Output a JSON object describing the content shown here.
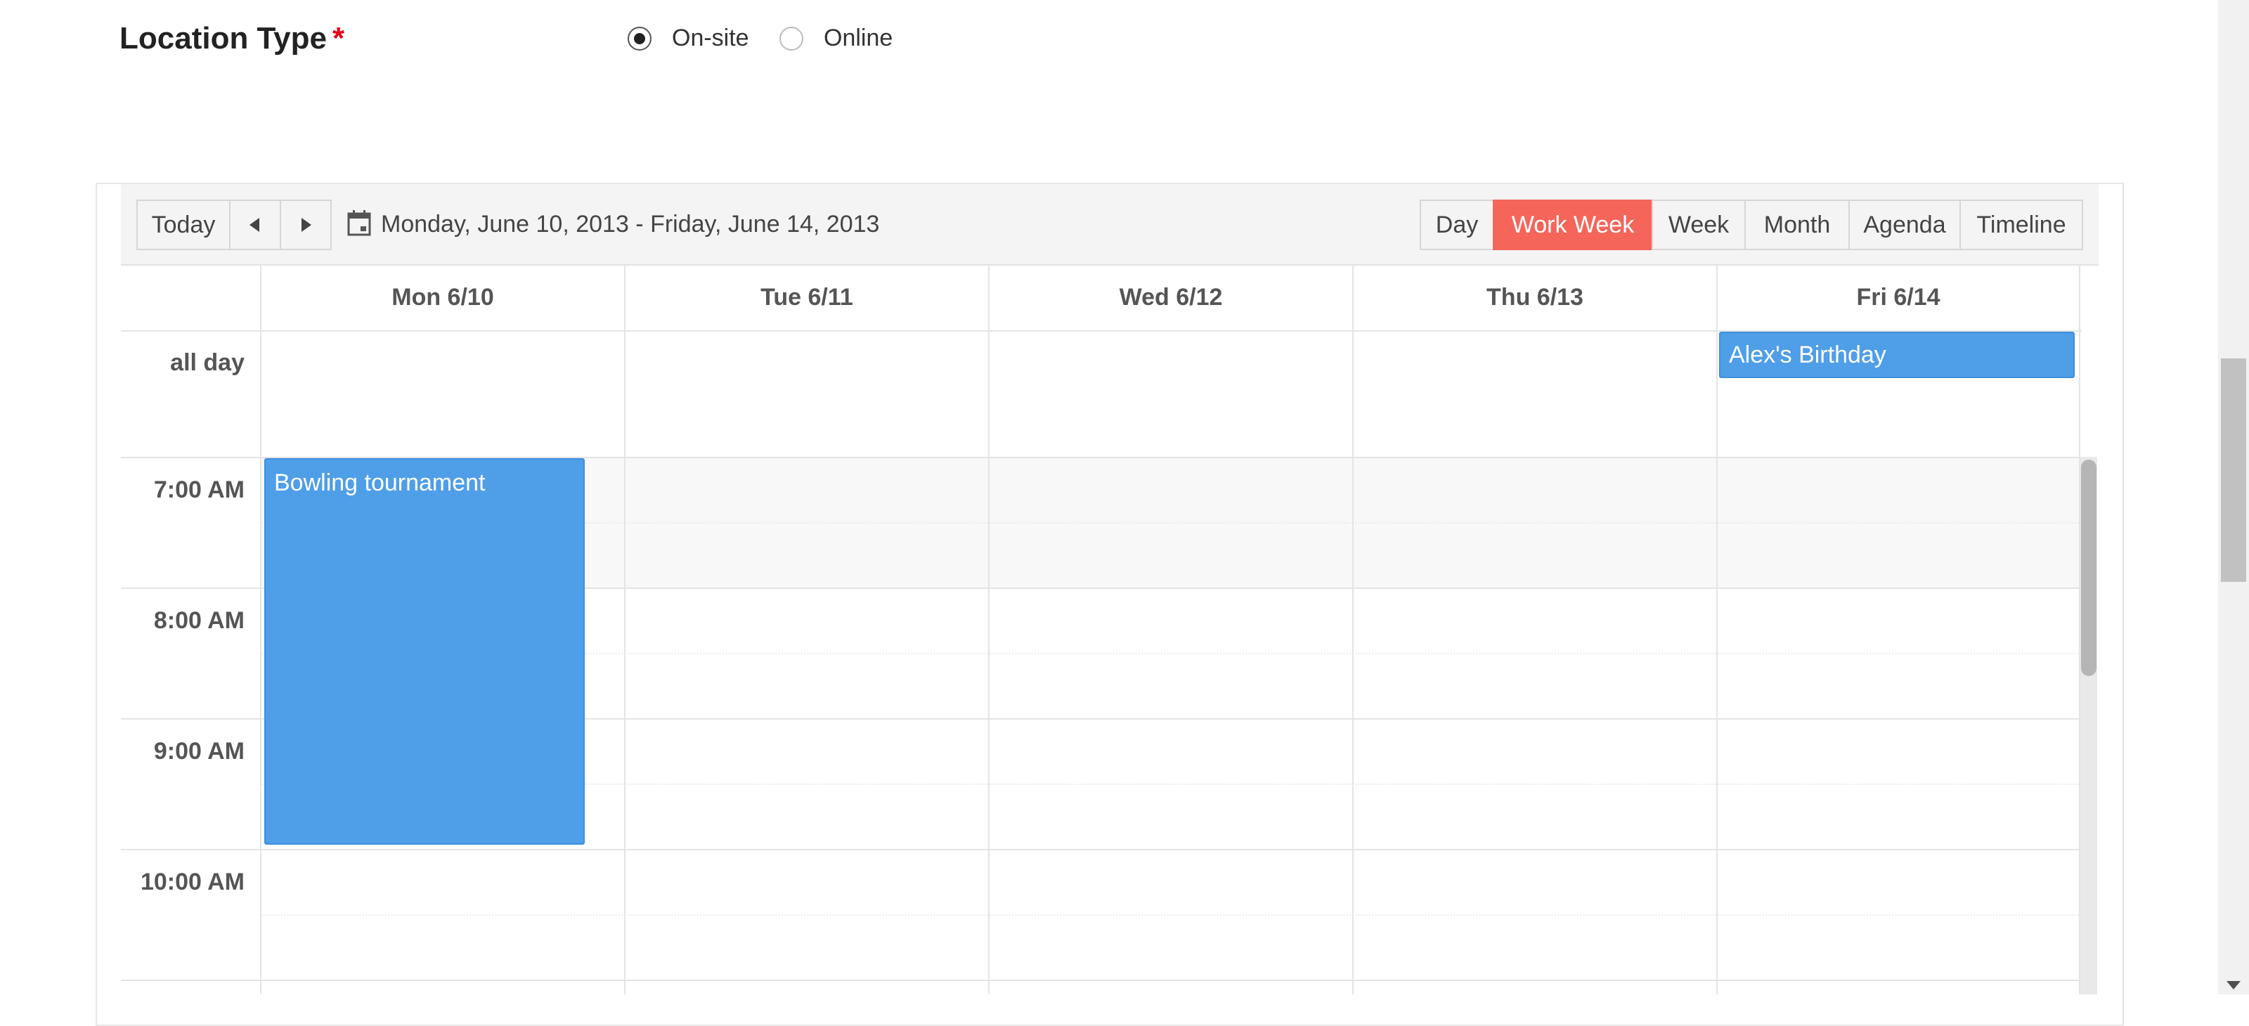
{
  "location": {
    "label": "Location Type",
    "required_mark": "*",
    "options": [
      {
        "label": "On-site",
        "checked": true
      },
      {
        "label": "Online",
        "checked": false
      }
    ]
  },
  "toolbar": {
    "today": "Today",
    "prev_icon": "chevron-left-icon",
    "next_icon": "chevron-right-icon",
    "calendar_icon": "calendar-icon",
    "date_range": "Monday, June 10, 2013 - Friday, June 14, 2013",
    "views": [
      "Day",
      "Work Week",
      "Week",
      "Month",
      "Agenda",
      "Timeline"
    ],
    "active_view": "Work Week"
  },
  "grid": {
    "days": [
      "Mon 6/10",
      "Tue 6/11",
      "Wed 6/12",
      "Thu 6/13",
      "Fri 6/14"
    ],
    "all_day_label": "all day",
    "times": [
      "7:00 AM",
      "8:00 AM",
      "9:00 AM",
      "10:00 AM"
    ]
  },
  "events": {
    "bowling": {
      "title": "Bowling tournament",
      "day": "Mon 6/10",
      "start": "7:00 AM",
      "end": "10:00 AM"
    },
    "birthday": {
      "title": "Alex's Birthday",
      "day": "Fri 6/14",
      "all_day": true
    }
  },
  "colors": {
    "accent_active": "#f5655a",
    "event": "#4f9ee8",
    "required": "#e3001b"
  }
}
